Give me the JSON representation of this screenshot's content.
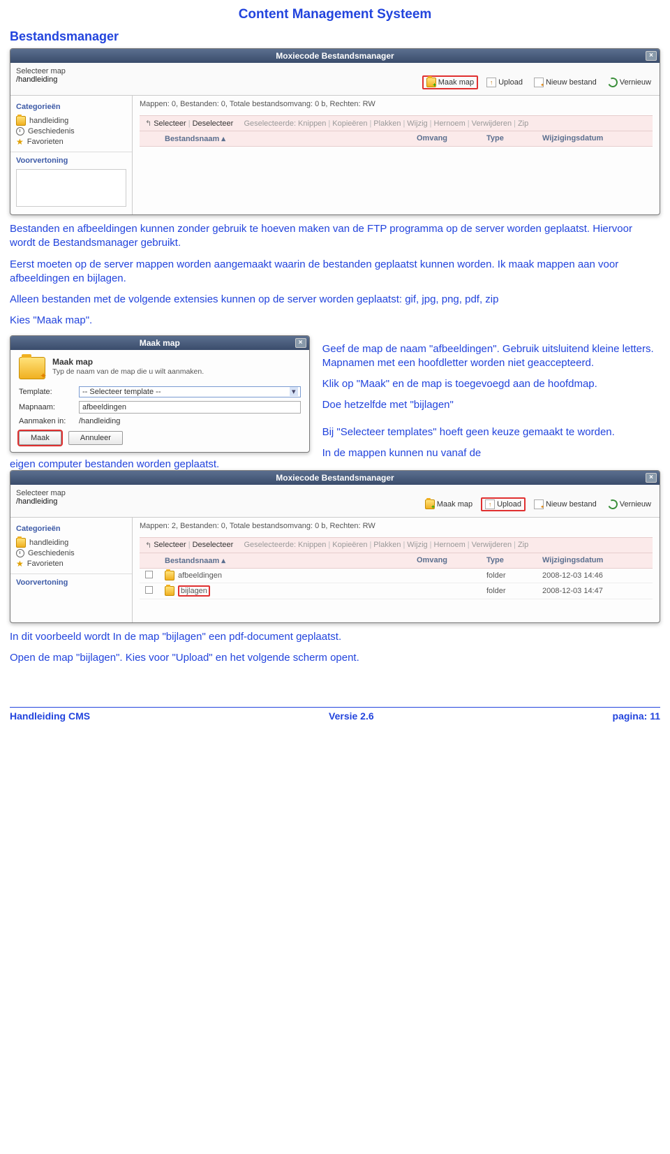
{
  "page_title": "Content Management Systeem",
  "section_heading": "Bestandsmanager",
  "para1": "Bestanden en afbeeldingen kunnen zonder gebruik te hoeven maken van de FTP programma op de server worden geplaatst. Hiervoor wordt de Bestandsmanager gebruikt.",
  "para2": "Eerst moeten op de server mappen worden aangemaakt waarin de bestanden geplaatst kunnen worden. Ik maak mappen aan voor afbeeldingen en bijlagen.",
  "para3": "Alleen bestanden met de volgende extensies kunnen op de server worden geplaatst: gif, jpg, png, pdf, zip",
  "kies_label": "Kies \"Maak map\".",
  "instructions_right": [
    "Geef de map de naam \"afbeeldingen\". Gebruik uitsluitend kleine letters. Mapnamen met een hoofdletter worden niet geaccepteerd.",
    "Klik op \"Maak\" en de map is toegevoegd aan de hoofdmap.",
    "Doe hetzelfde met \"bijlagen\"",
    "Bij \"Selecteer templates\" hoeft geen keuze gemaakt te worden.",
    "In de mappen kunnen nu vanaf de"
  ],
  "trail_left": "eigen computer bestanden worden geplaatst.",
  "para4": "In dit voorbeeld wordt In de map \"bijlagen\" een pdf-document geplaatst.",
  "para5": "Open de map \"bijlagen\". Kies voor \"Upload\" en het volgende scherm opent.",
  "footer": {
    "left": "Handleiding CMS",
    "center": "Versie 2.6",
    "right": "pagina: 11"
  },
  "fm_window_title": "Moxiecode Bestandsmanager",
  "fm_path_label": "Selecteer map",
  "fm": {
    "path": "/handleiding",
    "btns": {
      "mkfolder": "Maak map",
      "upload": "Upload",
      "newfile": "Nieuw bestand",
      "refresh": "Vernieuw"
    },
    "side": {
      "cats": "Categorieën",
      "item_folder": "handleiding",
      "item_history": "Geschiedenis",
      "item_fav": "Favorieten",
      "preview": "Voorvertoning"
    },
    "actions": {
      "select": "Selecteer",
      "deselect": "Deselecteer",
      "sel_label": "Geselecteerde:",
      "cut": "Knippen",
      "copy": "Kopieëren",
      "paste": "Plakken",
      "edit": "Wijzig",
      "rename": "Hernoem",
      "delete": "Verwijderen",
      "zip": "Zip"
    },
    "cols": {
      "name": "Bestandsnaam",
      "size": "Omvang",
      "type": "Type",
      "date": "Wijzigingsdatum"
    }
  },
  "fm1_status": "Mappen: 0, Bestanden: 0, Totale bestandsomvang: 0 b, Rechten: RW",
  "fm2_status": "Mappen: 2, Bestanden: 0, Totale bestandsomvang: 0 b, Rechten: RW",
  "fm2_rows": [
    {
      "name": "afbeeldingen",
      "type": "folder",
      "date": "2008-12-03 14:46",
      "hl": false
    },
    {
      "name": "bijlagen",
      "type": "folder",
      "date": "2008-12-03 14:47",
      "hl": true
    }
  ],
  "mm": {
    "title": "Maak map",
    "heading": "Maak map",
    "sub": "Typ de naam van de map die u wilt aanmaken.",
    "template_label": "Template:",
    "template_value": "-- Selecteer template --",
    "name_label": "Mapnaam:",
    "name_value": "afbeeldingen",
    "where_label": "Aanmaken in:",
    "where_value": "/handleiding",
    "btn_make": "Maak",
    "btn_cancel": "Annuleer"
  }
}
